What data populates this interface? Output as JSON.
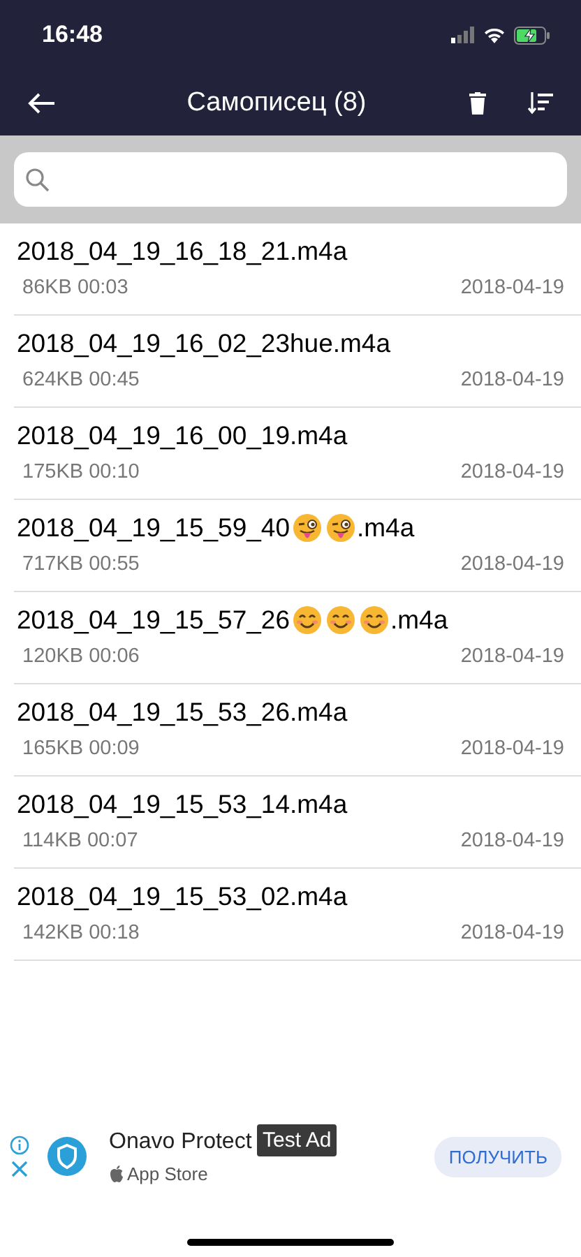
{
  "status_bar": {
    "time": "16:48"
  },
  "header": {
    "title": "Самописец (8)"
  },
  "recordings": [
    {
      "name": [
        {
          "kind": "text",
          "text": "2018_04_19_16_18_21.m4a"
        }
      ],
      "info": "86KB 00:03",
      "date": "2018-04-19"
    },
    {
      "name": [
        {
          "kind": "text",
          "text": "2018_04_19_16_02_23hue.m4a"
        }
      ],
      "info": "624KB 00:45",
      "date": "2018-04-19"
    },
    {
      "name": [
        {
          "kind": "text",
          "text": "2018_04_19_16_00_19.m4a"
        }
      ],
      "info": "175KB 00:10",
      "date": "2018-04-19"
    },
    {
      "name": [
        {
          "kind": "text",
          "text": "2018_04_19_15_59_40"
        },
        {
          "kind": "tongue"
        },
        {
          "kind": "tongue"
        },
        {
          "kind": "text",
          "text": ".m4a"
        }
      ],
      "info": "717KB 00:55",
      "date": "2018-04-19"
    },
    {
      "name": [
        {
          "kind": "text",
          "text": "2018_04_19_15_57_26"
        },
        {
          "kind": "smile"
        },
        {
          "kind": "smile"
        },
        {
          "kind": "smile"
        },
        {
          "kind": "text",
          "text": ".m4a"
        }
      ],
      "info": "120KB 00:06",
      "date": "2018-04-19"
    },
    {
      "name": [
        {
          "kind": "text",
          "text": "2018_04_19_15_53_26.m4a"
        }
      ],
      "info": "165KB 00:09",
      "date": "2018-04-19"
    },
    {
      "name": [
        {
          "kind": "text",
          "text": "2018_04_19_15_53_14.m4a"
        }
      ],
      "info": "114KB 00:07",
      "date": "2018-04-19"
    },
    {
      "name": [
        {
          "kind": "text",
          "text": "2018_04_19_15_53_02.m4a"
        }
      ],
      "info": "142KB 00:18",
      "date": "2018-04-19"
    }
  ],
  "ad": {
    "title": "Onavo Protect",
    "badge": "Test Ad",
    "store": "App Store",
    "button": "ПОЛУЧИТЬ"
  }
}
